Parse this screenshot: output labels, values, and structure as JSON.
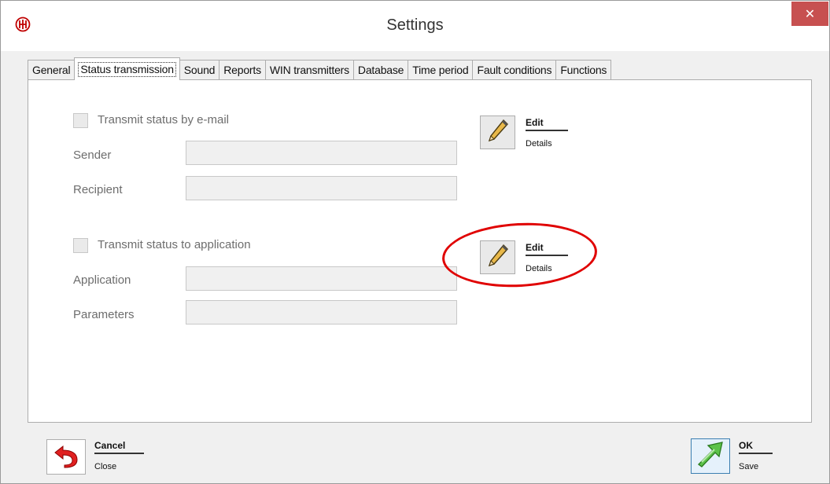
{
  "window": {
    "title": "Settings",
    "app_icon": "shield-logo-icon",
    "close_icon": "close-icon",
    "close_glyph": "✕"
  },
  "tabs": [
    {
      "label": "General",
      "active": false
    },
    {
      "label": "Status transmission",
      "active": true
    },
    {
      "label": "Sound",
      "active": false
    },
    {
      "label": "Reports",
      "active": false
    },
    {
      "label": "WIN transmitters",
      "active": false
    },
    {
      "label": "Database",
      "active": false
    },
    {
      "label": "Time period",
      "active": false
    },
    {
      "label": "Fault conditions",
      "active": false
    },
    {
      "label": "Functions",
      "active": false
    }
  ],
  "email": {
    "checkbox_label": "Transmit status by e-mail",
    "checked": false,
    "sender_label": "Sender",
    "sender_value": "",
    "recipient_label": "Recipient",
    "recipient_value": "",
    "edit_title": "Edit",
    "edit_sub": "Details",
    "edit_icon": "pencil-icon"
  },
  "application": {
    "checkbox_label": "Transmit status to application",
    "checked": false,
    "application_label": "Application",
    "application_value": "",
    "parameters_label": "Parameters",
    "parameters_value": "",
    "edit_title": "Edit",
    "edit_sub": "Details",
    "edit_icon": "pencil-icon",
    "highlight_color": "#e00000"
  },
  "footer": {
    "cancel_title": "Cancel",
    "cancel_sub": "Close",
    "cancel_icon": "undo-arrow-icon",
    "ok_title": "OK",
    "ok_sub": "Save",
    "ok_icon": "green-arrow-icon"
  }
}
